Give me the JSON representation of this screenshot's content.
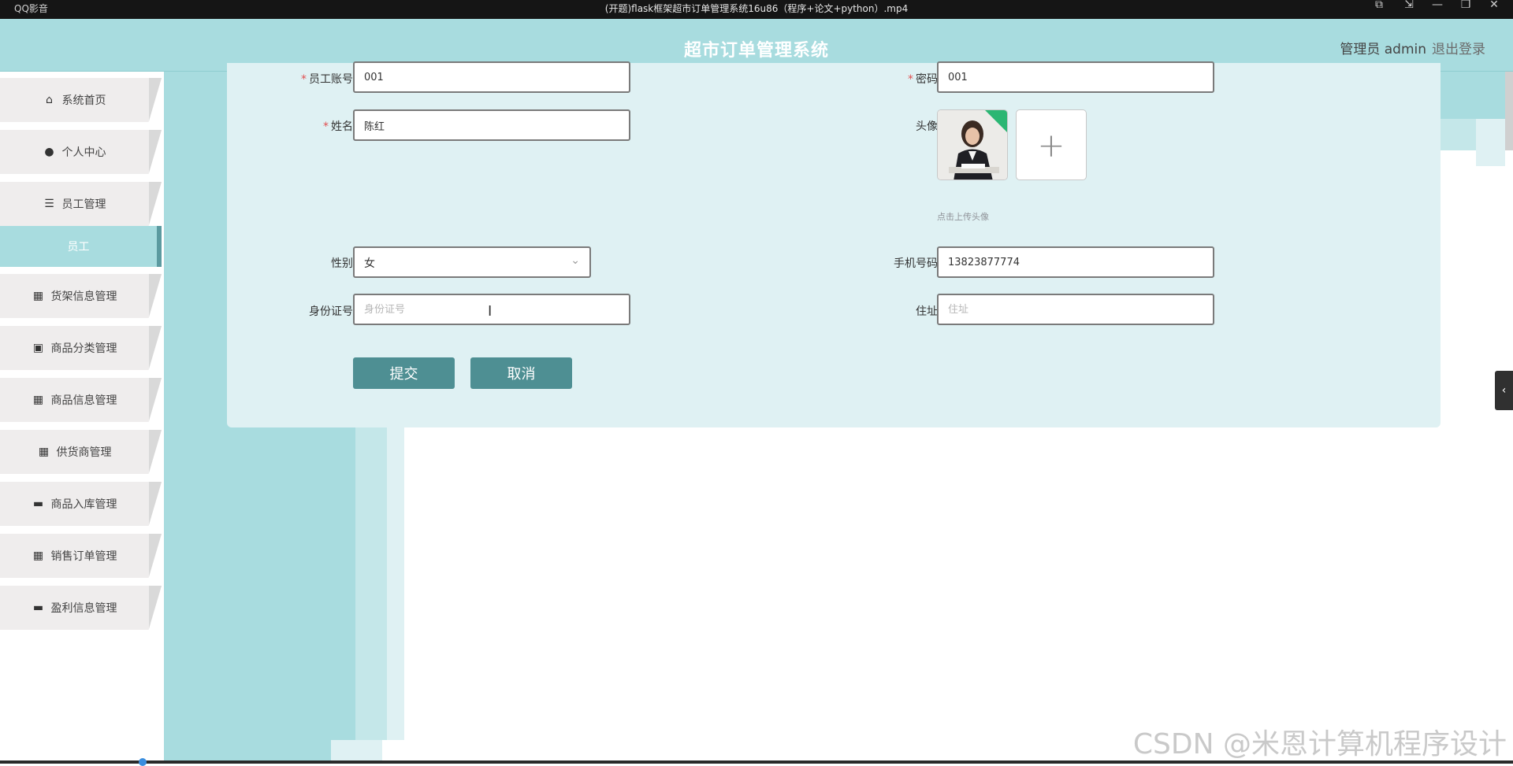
{
  "player": {
    "app_name": "QQ影音",
    "video_title": "(开题)flask框架超市订单管理系统16u86（程序+论文+python）.mp4",
    "controls": [
      "⧉",
      "⇲",
      "—",
      "❐",
      "✕"
    ]
  },
  "header": {
    "title": "超市订单管理系统",
    "user": "管理员 admin",
    "logout": "退出登录"
  },
  "sidebar": {
    "items": [
      {
        "label": "系统首页",
        "icon": "home-icon",
        "glyph": "⌂"
      },
      {
        "label": "个人中心",
        "icon": "user-icon",
        "glyph": "●"
      },
      {
        "label": "员工管理",
        "icon": "list-icon",
        "glyph": "☰"
      },
      {
        "label": "员工",
        "icon": "",
        "glyph": "",
        "active": true
      },
      {
        "label": "货架信息管理",
        "icon": "grid-icon",
        "glyph": "▦"
      },
      {
        "label": "商品分类管理",
        "icon": "clipboard-icon",
        "glyph": "▣"
      },
      {
        "label": "商品信息管理",
        "icon": "apps-icon",
        "glyph": "▦"
      },
      {
        "label": "供货商管理",
        "icon": "grid-icon",
        "glyph": "▦"
      },
      {
        "label": "商品入库管理",
        "icon": "chat-icon",
        "glyph": "▬"
      },
      {
        "label": "销售订单管理",
        "icon": "grid-icon",
        "glyph": "▦"
      },
      {
        "label": "盈利信息管理",
        "icon": "monitor-icon",
        "glyph": "▬"
      }
    ]
  },
  "form": {
    "account_label": "员工账号",
    "account_value": "001",
    "password_label": "密码",
    "password_value": "001",
    "name_label": "姓名",
    "name_value": "陈红",
    "avatar_label": "头像",
    "avatar_hint": "点击上传头像",
    "avatar_add": "+",
    "gender_label": "性别",
    "gender_value": "女",
    "phone_label": "手机号码",
    "phone_value": "13823877774",
    "idcard_label": "身份证号",
    "idcard_placeholder": "身份证号",
    "address_label": "住址",
    "address_placeholder": "住址",
    "submit": "提交",
    "cancel": "取消"
  },
  "watermark": "CSDN @米恩计算机程序设计",
  "colors": {
    "header_bg": "#a8dcdf",
    "card_bg": "#dff1f3",
    "button_bg": "#4e8f93",
    "required_mark": "#e05050"
  }
}
